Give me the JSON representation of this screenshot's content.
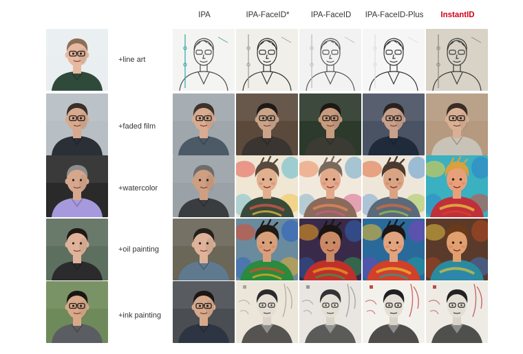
{
  "columns": [
    {
      "label": "IPA",
      "highlight": false
    },
    {
      "label": "IPA-FaceID*",
      "highlight": false
    },
    {
      "label": "IPA-FaceID",
      "highlight": false
    },
    {
      "label": "IPA-FaceID-Plus",
      "highlight": false
    },
    {
      "label": "InstantID",
      "highlight": true
    }
  ],
  "rows": [
    {
      "prompt": "+line art",
      "reference": {
        "bg": "#e9eef0",
        "skin": "#e7b9a0",
        "hair": "#8c6e56",
        "shirt": "#2f4a3a",
        "glasses": true
      },
      "results": [
        {
          "style": "line",
          "bg": "#f4f4f2",
          "ink": "#4a4a4a",
          "accent": "#2aa6a6"
        },
        {
          "style": "line",
          "bg": "#f1efe9",
          "ink": "#2d2d2d",
          "accent": "#9a9a9a"
        },
        {
          "style": "line",
          "bg": "#f2f2f2",
          "ink": "#555555",
          "accent": "#bbbbbb"
        },
        {
          "style": "line",
          "bg": "#f6f6f6",
          "ink": "#333333",
          "accent": "#dddddd"
        },
        {
          "style": "line",
          "bg": "#d8d2c7",
          "ink": "#3a3a3a",
          "accent": "#8d8578"
        }
      ]
    },
    {
      "prompt": "+faded film",
      "reference": {
        "bg": "#b7bec4",
        "skin": "#d8a98e",
        "hair": "#3b2f2a",
        "shirt": "#2b2f36",
        "glasses": true
      },
      "results": [
        {
          "style": "photo",
          "bg": "#9fa7ad",
          "skin": "#d9ab90",
          "hair": "#3e322c",
          "shirt": "#4b5a66",
          "glasses": true
        },
        {
          "style": "photo",
          "bg": "#5b4a3c",
          "skin": "#caa489",
          "hair": "#1f1a17",
          "shirt": "#3a3530",
          "glasses": true
        },
        {
          "style": "photo",
          "bg": "#2c3a2c",
          "skin": "#c79b7d",
          "hair": "#1c1816",
          "shirt": "#3b3b34",
          "glasses": true
        },
        {
          "style": "photo",
          "bg": "#4a5364",
          "skin": "#c9a08a",
          "hair": "#2a2220",
          "shirt": "#1f2a3a",
          "glasses": true
        },
        {
          "style": "photo",
          "bg": "#b59a80",
          "skin": "#d9b094",
          "hair": "#3a2c24",
          "shirt": "#c9c3b7",
          "glasses": true
        }
      ]
    },
    {
      "prompt": "+watercolor",
      "reference": {
        "bg": "#2a2a2a",
        "skin": "#d6a78c",
        "hair": "#8d8d8d",
        "shirt": "#a79adc",
        "glasses": false
      },
      "results": [
        {
          "style": "photo",
          "bg": "#9aa2a8",
          "skin": "#cf9f82",
          "hair": "#6d6d6d",
          "shirt": "#3a3d40",
          "glasses": false
        },
        {
          "style": "paint",
          "bg": "#f0e6d4",
          "skin": "#e1b08e",
          "hair": "#5a4a3e",
          "shirt": "#3a4a3a",
          "c1": "#e2554a",
          "c2": "#4cb3c9",
          "c3": "#f2c23e"
        },
        {
          "style": "paint",
          "bg": "#f2e9dd",
          "skin": "#e2a98a",
          "hair": "#7a6a5e",
          "shirt": "#8a6a5a",
          "c1": "#e98b5a",
          "c2": "#5aa0c8",
          "c3": "#d35a8a"
        },
        {
          "style": "paint",
          "bg": "#efe6da",
          "skin": "#d9a483",
          "hair": "#4a3a30",
          "shirt": "#5a6a7a",
          "c1": "#e06a3a",
          "c2": "#4a8fd0",
          "c3": "#9ac84a"
        },
        {
          "style": "paint",
          "bg": "#3ab0c0",
          "skin": "#e8a07a",
          "hair": "#d9a040",
          "shirt": "#c0303a",
          "c1": "#f0d040",
          "c2": "#2a7ac8",
          "c3": "#e0402a"
        }
      ]
    },
    {
      "prompt": "+oil painting",
      "reference": {
        "bg": "#5d6f5f",
        "skin": "#e0b29a",
        "hair": "#1f1915",
        "shirt": "#2b2b2e",
        "glasses": false
      },
      "results": [
        {
          "style": "photo",
          "bg": "#6a6658",
          "skin": "#deb39a",
          "hair": "#24201c",
          "shirt": "#5f7a8e",
          "glasses": false
        },
        {
          "style": "paint",
          "bg": "#6a8a9e",
          "skin": "#d8a07a",
          "hair": "#1f1a16",
          "shirt": "#2a8a3e",
          "c1": "#e04a2a",
          "c2": "#1f5ac8",
          "c3": "#f0b020"
        },
        {
          "style": "paint",
          "bg": "#3a2a4a",
          "skin": "#c98a66",
          "hair": "#1a1512",
          "shirt": "#c0302a",
          "c1": "#f0a020",
          "c2": "#2a6ac0",
          "c3": "#30a050"
        },
        {
          "style": "paint",
          "bg": "#2a6a9a",
          "skin": "#e0a47e",
          "hair": "#1c1714",
          "shirt": "#d0402a",
          "c1": "#f0c030",
          "c2": "#8a3ac0",
          "c3": "#20a0a0"
        },
        {
          "style": "paint",
          "bg": "#5a3a2a",
          "skin": "#e0a070",
          "hair": "#6a3a1a",
          "shirt": "#2a8aa0",
          "c1": "#e0c040",
          "c2": "#c04a20",
          "c3": "#3a7ad0"
        }
      ]
    },
    {
      "prompt": "+ink painting",
      "reference": {
        "bg": "#6f8a5a",
        "skin": "#d8a888",
        "hair": "#1a1614",
        "shirt": "#5a5e62",
        "glasses": true
      },
      "results": [
        {
          "style": "photo",
          "bg": "#4a4e52",
          "skin": "#d6a98c",
          "hair": "#1b1715",
          "shirt": "#2e3542",
          "glasses": true
        },
        {
          "style": "ink",
          "bg": "#ece6da",
          "ink": "#2a2a2a",
          "accent": "#9a9a8a"
        },
        {
          "style": "ink",
          "bg": "#e9e6e1",
          "ink": "#333333",
          "accent": "#8a8a8a"
        },
        {
          "style": "ink",
          "bg": "#f3f1ec",
          "ink": "#1f1f1f",
          "accent": "#c02a2a"
        },
        {
          "style": "ink",
          "bg": "#eeebe4",
          "ink": "#222222",
          "accent": "#b03030"
        }
      ]
    }
  ]
}
